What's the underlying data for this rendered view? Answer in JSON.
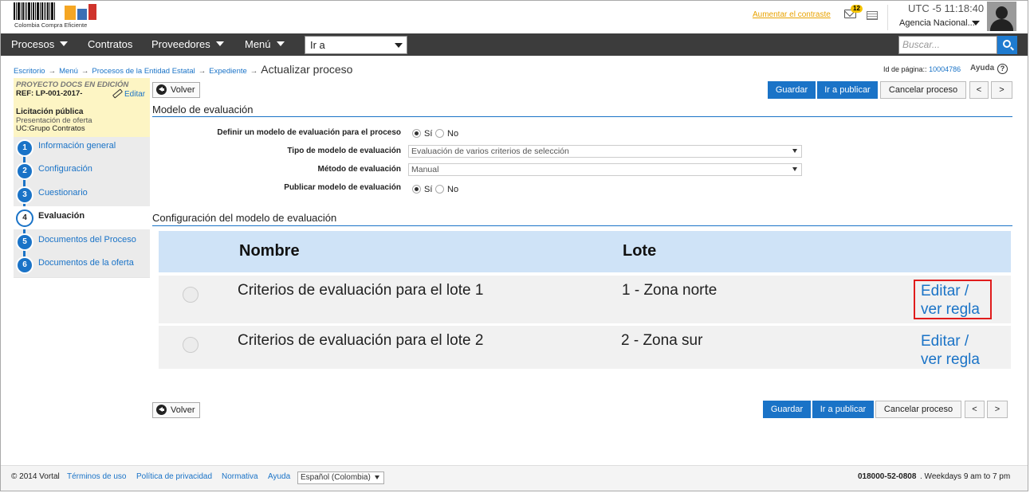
{
  "header": {
    "logo_text": "Colombia Compra Eficiente",
    "contrast_link": "Aumentar el contraste",
    "notifications_count": "12",
    "time": "UTC -5 11:18:40",
    "agency": "Agencia Nacional..."
  },
  "nav": {
    "items": [
      "Procesos",
      "Contratos",
      "Proveedores",
      "Menú"
    ],
    "goto_value": "Ir a",
    "search_placeholder": "Buscar..."
  },
  "breadcrumb": {
    "items": [
      "Escritorio",
      "Menú",
      "Procesos de la Entidad Estatal",
      "Expediente"
    ],
    "separator": "→",
    "current": "Actualizar proceso"
  },
  "page_id": {
    "label": "Id de página::",
    "value": "10004786"
  },
  "help_label": "Ayuda",
  "sidebar": {
    "project_label": "PROYECTO DOCS EN EDICIÓN",
    "ref": "REF: LP-001-2017-",
    "edit_label": "Editar",
    "process_type": "Licitación pública",
    "phase": "Presentación de oferta",
    "unit": "UC:Grupo Contratos",
    "steps": [
      {
        "num": "1",
        "label": "Información general"
      },
      {
        "num": "2",
        "label": "Configuración"
      },
      {
        "num": "3",
        "label": "Cuestionario"
      },
      {
        "num": "4",
        "label": "Evaluación"
      },
      {
        "num": "5",
        "label": "Documentos del Proceso"
      },
      {
        "num": "6",
        "label": "Documentos de la oferta"
      }
    ],
    "active_step": "4"
  },
  "actions": {
    "back": "Volver",
    "save": "Guardar",
    "publish": "Ir a publicar",
    "cancel": "Cancelar proceso",
    "prev": "<",
    "next": ">"
  },
  "model_section": {
    "title": "Modelo de evaluación",
    "fields": [
      {
        "label": "Definir un modelo de evaluación para el proceso",
        "type": "radio",
        "options": [
          "Sí",
          "No"
        ],
        "selected": "Sí"
      },
      {
        "label": "Tipo de modelo de evaluación",
        "type": "select",
        "value": "Evaluación de varios criterios de selección"
      },
      {
        "label": "Método de evaluación",
        "type": "select",
        "value": "Manual"
      },
      {
        "label": "Publicar modelo de evaluación",
        "type": "radio",
        "options": [
          "Sí",
          "No"
        ],
        "selected": "Sí"
      }
    ]
  },
  "config_section": {
    "title": "Configuración del modelo de evaluación",
    "columns": [
      "Nombre",
      "Lote"
    ],
    "rows": [
      {
        "name": "Criterios de evaluación para el lote 1",
        "lot": "1 - Zona norte",
        "action_line1": "Editar /",
        "action_line2": "ver regla"
      },
      {
        "name": "Criterios de evaluación para el lote 2",
        "lot": "2 - Zona sur",
        "action_line1": "Editar /",
        "action_line2": "ver regla"
      }
    ]
  },
  "footer": {
    "copyright": "© 2014 Vortal",
    "links": [
      "Términos de uso",
      "Política de privacidad",
      "Normativa",
      "Ayuda"
    ],
    "language": "Español (Colombia)",
    "phone": "018000-52-0808",
    "hours": ". Weekdays 9 am to 7 pm"
  },
  "colors": {
    "accent": "#1a73c7",
    "nav_bg": "#3c3c3c",
    "highlight_border": "#e01c1c",
    "table_header_bg": "#cfe3f7",
    "sidebar_header_bg": "#fdf5c4",
    "contrast_link": "#e8a200"
  }
}
